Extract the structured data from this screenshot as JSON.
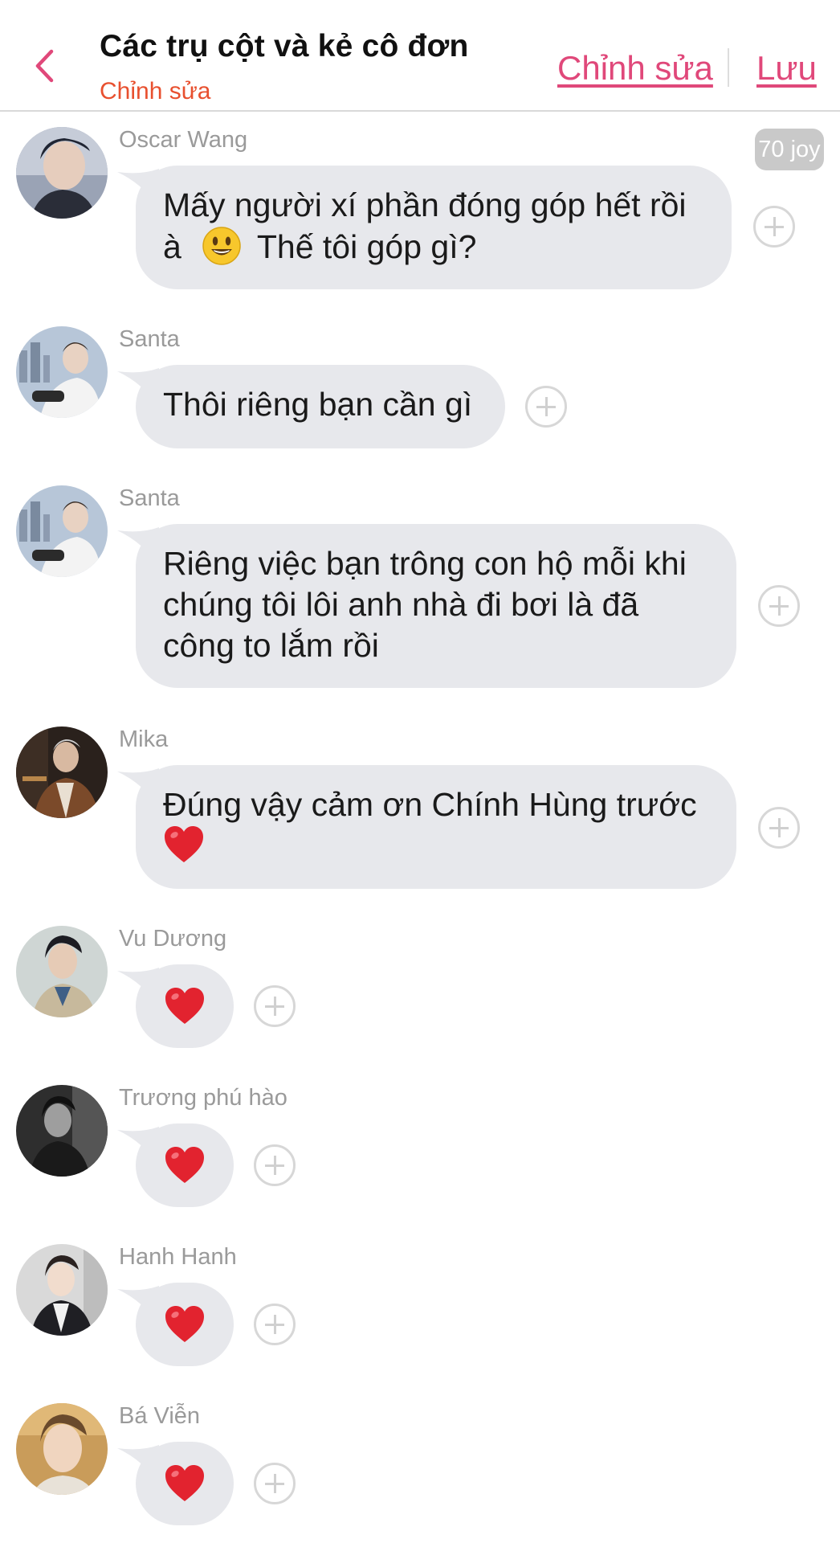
{
  "header": {
    "title": "Các trụ cột và kẻ cô đơn",
    "subtitle": "Chỉnh sửa",
    "edit_label": "Chỉnh sửa",
    "save_label": "Lưu",
    "back_icon": "chevron-left-icon",
    "accent_color": "#e0487a",
    "subtitle_color": "#e8502f"
  },
  "joy_badge": "70 joy",
  "messages": [
    {
      "sender": "Oscar Wang",
      "lines": [
        "Mấy người xí phần đóng góp hết rồi",
        "à",
        "Thế tôi góp gì?"
      ],
      "emoji": "smiley-face"
    },
    {
      "sender": "Santa",
      "lines": [
        "Thôi riêng bạn cần gì"
      ]
    },
    {
      "sender": "Santa",
      "lines": [
        "Riêng việc bạn trông con hộ mỗi khi",
        "chúng tôi lôi anh nhà đi bơi là đã",
        "công to lắm rồi"
      ]
    },
    {
      "sender": "Mika",
      "lines": [
        "Đúng vậy cảm ơn Chính Hùng trước"
      ],
      "emoji": "red-heart"
    },
    {
      "sender": "Vu Dương",
      "emoji": "red-heart"
    },
    {
      "sender": "Trương phú hào",
      "emoji": "red-heart"
    },
    {
      "sender": "Hanh Hanh",
      "emoji": "red-heart"
    },
    {
      "sender": "Bá Viễn",
      "emoji": "red-heart"
    }
  ],
  "colors": {
    "bubble": "#e7e8ec",
    "sender_name": "#9a9a9a",
    "plus_circle": "#d7d7d7",
    "joy_badge": "#c9c9c9"
  }
}
